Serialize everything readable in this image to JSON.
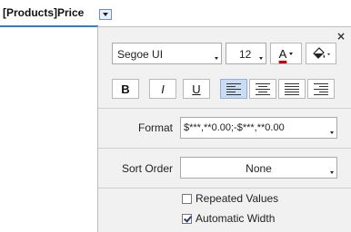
{
  "field": {
    "title": "[Products]Price"
  },
  "panel": {
    "close_glyph": "×",
    "font": {
      "family": "Segoe UI",
      "size": "12",
      "color_label": "A"
    },
    "style_buttons": {
      "bold": "B",
      "italic": "I",
      "underline": "U"
    },
    "alignment": {
      "selected": "left"
    },
    "format": {
      "label": "Format",
      "value": "$***,**0.00;-$***,**0.00"
    },
    "sort_order": {
      "label": "Sort Order",
      "value": "None"
    },
    "options": [
      {
        "label": "Repeated Values",
        "checked": false
      },
      {
        "label": "Automatic Width",
        "checked": true
      }
    ]
  },
  "colors": {
    "accent_underline": "#2f7fc9",
    "font_color": "#d00000",
    "selected_button": "#c9dcf2"
  }
}
